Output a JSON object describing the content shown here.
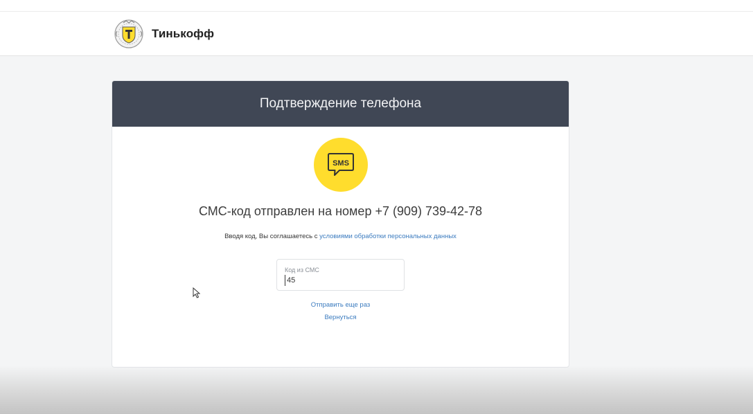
{
  "header": {
    "brand_name": "Тинькофф",
    "logo_icon": "tinkoff-emblem-icon"
  },
  "card": {
    "title": "Подтверждение телефона",
    "sms_icon": {
      "name": "sms-bubble-icon",
      "text": "SMS",
      "bg_color": "#ffdd2d"
    },
    "sent_message": "СМС-код отправлен на номер +7 (909) 739-42-78",
    "consent_text": "Вводя код, Вы соглашаетесь с ",
    "consent_link": "условиями обработки персональных данных",
    "code_field": {
      "label": "Код из СМС",
      "value": "45"
    },
    "resend_link": "Отправить еще раз",
    "back_link": "Вернуться"
  },
  "colors": {
    "header_bg": "#404755",
    "accent_yellow": "#ffdd2d",
    "link_blue": "#3b7bbf"
  }
}
